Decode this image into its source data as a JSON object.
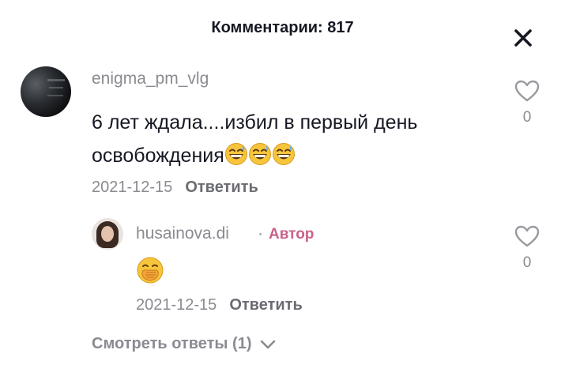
{
  "header": {
    "title": "Комментарии: 817"
  },
  "close": {
    "icon": "close-icon"
  },
  "comment": {
    "username": "enigma_pm_vlg",
    "text": "6 лет ждала....избил в первый день освобождения",
    "emojis": [
      "grinning-sweat-emoji",
      "grinning-sweat-emoji",
      "grinning-sweat-emoji"
    ],
    "date": "2021-12-15",
    "reply_label": "Ответить",
    "likes": "0"
  },
  "reply": {
    "username": "husainova.di",
    "separator": "·",
    "badge": "Автор",
    "emoji": "hand-over-mouth-emoji",
    "date": "2021-12-15",
    "reply_label": "Ответить",
    "likes": "0"
  },
  "view_replies": {
    "label": "Смотреть ответы (1)"
  },
  "colors": {
    "author_badge": "#c9628a",
    "muted": "#8a8b91",
    "text": "#161823"
  }
}
